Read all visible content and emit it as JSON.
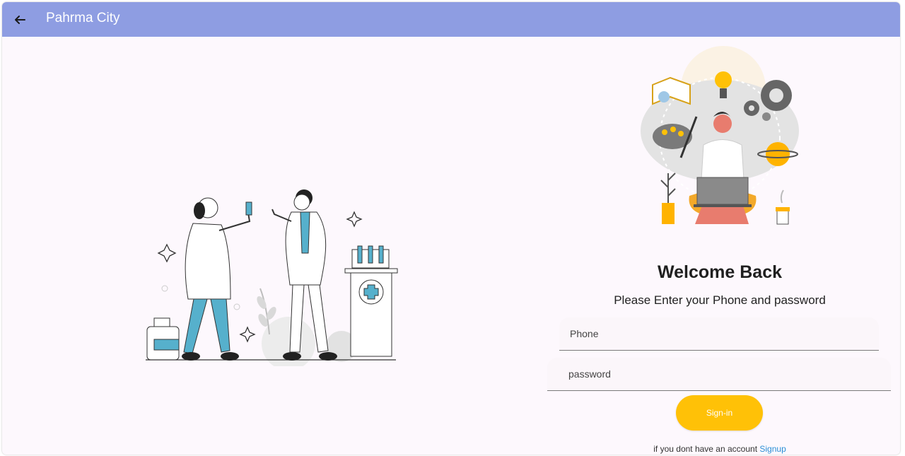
{
  "appbar": {
    "title": "Pahrma City",
    "back_icon": "arrow-back-icon",
    "color": "#8e9de2"
  },
  "illustrations": {
    "left": "doctors-illustration",
    "right": "person-with-laptop-illustration"
  },
  "login": {
    "heading": "Welcome Back",
    "subtitle": "Please Enter your Phone and password",
    "phone_placeholder": "Phone",
    "password_placeholder": "password",
    "signin_label": "Sign-in",
    "signin_color": "#ffc107",
    "signup_prompt": "if you dont have an account",
    "signup_link": "Signup"
  }
}
